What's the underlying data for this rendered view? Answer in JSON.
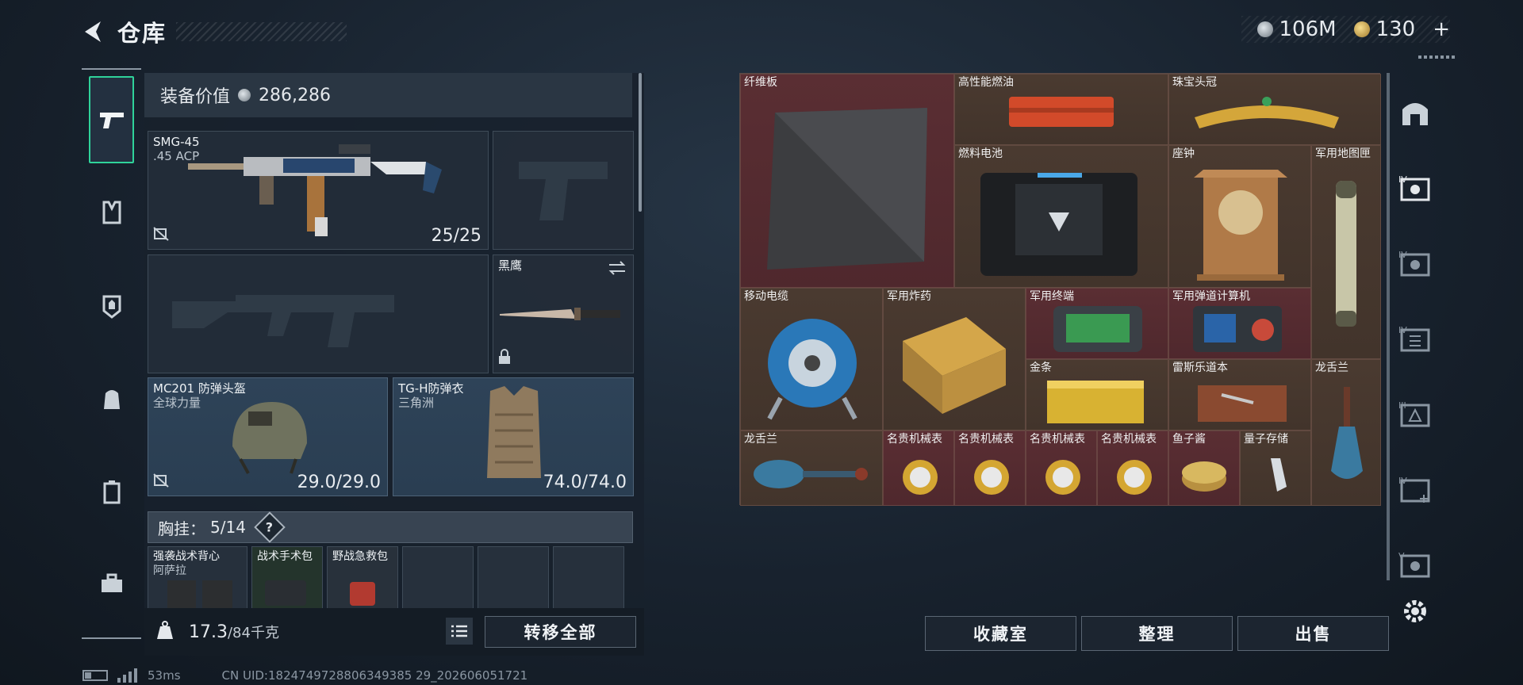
{
  "header": {
    "title": "仓库"
  },
  "currency": {
    "silver_value": "106M",
    "gold_value": "130",
    "plus_label": "+"
  },
  "equipment": {
    "value_label": "装备价值",
    "value": "286,286",
    "primary": {
      "name": "SMG-45",
      "ammo": ".45 ACP",
      "count": "25/25"
    },
    "knife": {
      "name": "黑鹰"
    },
    "helmet": {
      "name": "MC201 防弹头盔",
      "faction": "全球力量",
      "durability": "29.0/29.0"
    },
    "armor": {
      "name": "TG-H防弹衣",
      "faction": "三角洲",
      "durability": "74.0/74.0"
    },
    "chest_label": "胸挂：",
    "chest_count": "5/14",
    "help": "?",
    "backpack_slots": [
      {
        "name": "强袭战术背心",
        "sub": "阿萨拉"
      },
      {
        "name": "战术手术包",
        "sub": ""
      },
      {
        "name": "野战急救包",
        "sub": ""
      }
    ],
    "weight": "17.3",
    "weight_max": "/84千克",
    "transfer_all": "转移全部"
  },
  "status": {
    "ping": "53ms",
    "uid": "CN UID:1824749728806349385 29_202606051721"
  },
  "storage": {
    "items": [
      {
        "name": "纤维板"
      },
      {
        "name": "高性能燃油"
      },
      {
        "name": "珠宝头冠"
      },
      {
        "name": "燃料电池"
      },
      {
        "name": "座钟"
      },
      {
        "name": "军用地图匣"
      },
      {
        "name": "移动电缆"
      },
      {
        "name": "军用炸药"
      },
      {
        "name": "军用终端"
      },
      {
        "name": "军用弹道计算机"
      },
      {
        "name": "金条"
      },
      {
        "name": "雷斯乐道本"
      },
      {
        "name": "龙舌兰"
      },
      {
        "name": "龙舌兰"
      },
      {
        "name": "名贵机械表"
      },
      {
        "name": "名贵机械表"
      },
      {
        "name": "名贵机械表"
      },
      {
        "name": "名贵机械表"
      },
      {
        "name": "鱼子酱"
      },
      {
        "name": "量子存储"
      }
    ],
    "buttons": {
      "collection": "收藏室",
      "sort": "整理",
      "sell": "出售"
    }
  },
  "right_rail": [
    "home-tier",
    "tier-IV",
    "tier-IV",
    "tier-IV",
    "tier-III",
    "tier-IV-plus",
    "tier-V"
  ],
  "colors": {
    "accent": "#2fd39a",
    "red_cell": "#5a2e33",
    "brown_cell": "#4a3a30",
    "blue_slot": "#2e4358"
  }
}
